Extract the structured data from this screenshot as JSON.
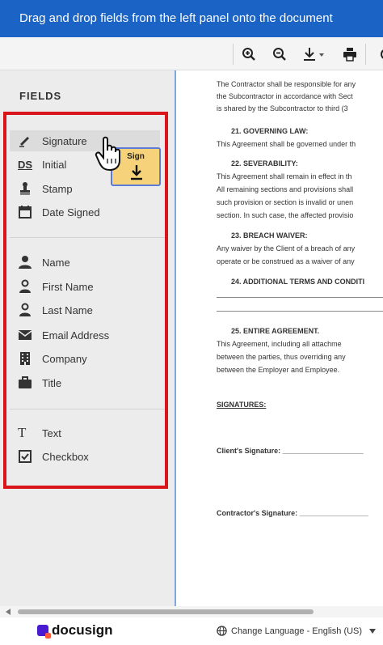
{
  "banner": {
    "text": "Drag and drop fields from the left panel onto the document"
  },
  "toolbar": {
    "icons": [
      "zoom-in-icon",
      "zoom-out-icon",
      "download-icon",
      "print-icon",
      "more-icon"
    ]
  },
  "sidebar": {
    "title": "FIELDS",
    "group1": [
      {
        "label": "Signature",
        "icon": "pen-icon"
      },
      {
        "label": "Initial",
        "icon": "ds-icon"
      },
      {
        "label": "Stamp",
        "icon": "stamp-icon"
      },
      {
        "label": "Date Signed",
        "icon": "calendar-icon"
      }
    ],
    "group2": [
      {
        "label": "Name",
        "icon": "person-icon"
      },
      {
        "label": "First Name",
        "icon": "person-icon"
      },
      {
        "label": "Last Name",
        "icon": "person-icon"
      },
      {
        "label": "Email Address",
        "icon": "envelope-icon"
      },
      {
        "label": "Company",
        "icon": "building-icon"
      },
      {
        "label": "Title",
        "icon": "briefcase-icon"
      }
    ],
    "group3": [
      {
        "label": "Text",
        "icon": "text-icon"
      },
      {
        "label": "Checkbox",
        "icon": "checkbox-icon"
      }
    ],
    "initial_icon_text": "DS"
  },
  "drag_tooltip": {
    "label": "Sign"
  },
  "document": {
    "lines": [
      "The Contractor shall be responsible for any",
      "the Subcontractor in accordance with Sect",
      "is shared by the Subcontractor to third (3",
      "21. GOVERNING LAW:",
      "This Agreement shall be governed under th",
      "22. SEVERABILITY:",
      "This Agreement shall remain in effect in th",
      "All remaining sections and provisions shall",
      "such provision or section is invalid or unen",
      "section. In such case, the affected provisio",
      "23. BREACH WAIVER:",
      "Any waiver by the Client of a breach of any",
      "operate or be construed as a waiver of any",
      "24. ADDITIONAL TERMS AND CONDITI",
      "25. ENTIRE AGREEMENT.",
      "This Agreement, including all attachme",
      "between the parties, thus overriding any",
      "between the Employer and Employee.",
      "SIGNATURES:",
      "Client's Signature: ____________________",
      "Contractor's Signature: _________________"
    ]
  },
  "footer": {
    "brand": "docusign",
    "language": "Change Language - English (US)"
  }
}
